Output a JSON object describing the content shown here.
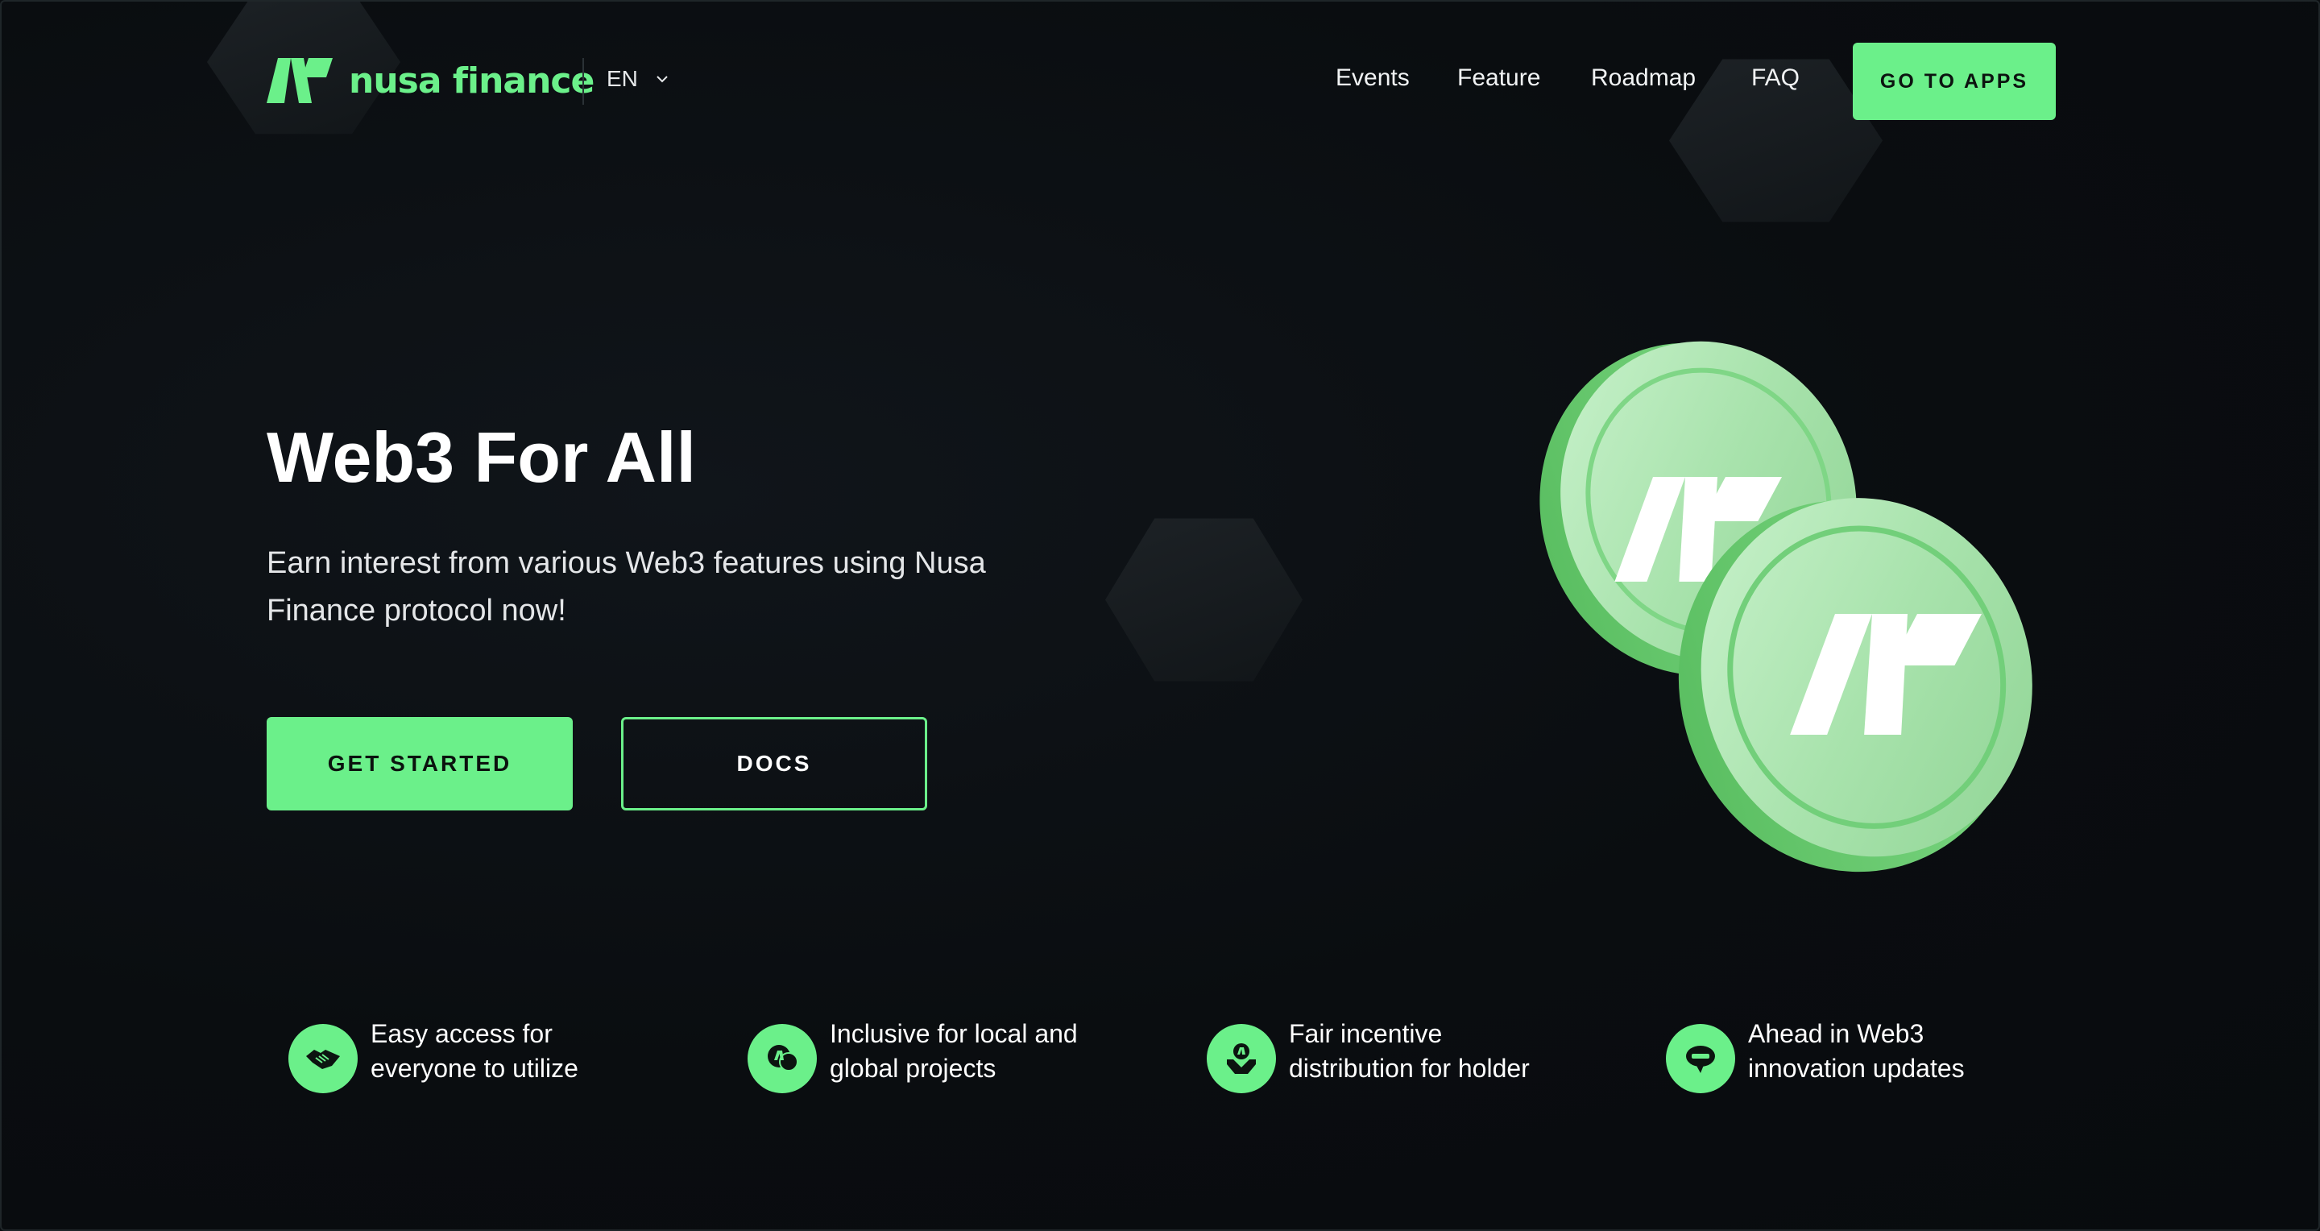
{
  "brand": {
    "name": "nusa finance",
    "accent": "#6bf08a",
    "background": "#0a0d10"
  },
  "header": {
    "language": "EN",
    "nav": [
      "Events",
      "Feature",
      "Roadmap",
      "FAQ"
    ],
    "cta": "GO TO APPS"
  },
  "hero": {
    "title": "Web3 For All",
    "subtitle_line1": "Earn interest from various Web3 features using Nusa",
    "subtitle_line2": "Finance protocol now!",
    "primary_button": "GET STARTED",
    "secondary_button": "DOCS"
  },
  "features": [
    {
      "icon": "handshake-icon",
      "line1": "Easy access for",
      "line2": "everyone to utilize"
    },
    {
      "icon": "chat-bubbles-icon",
      "line1": "Inclusive for local and",
      "line2": "global projects"
    },
    {
      "icon": "hands-giving-icon",
      "line1": "Fair incentive",
      "line2": "distribution for holder"
    },
    {
      "icon": "news-chat-icon",
      "line1": "Ahead in Web3",
      "line2": "innovation updates"
    }
  ]
}
